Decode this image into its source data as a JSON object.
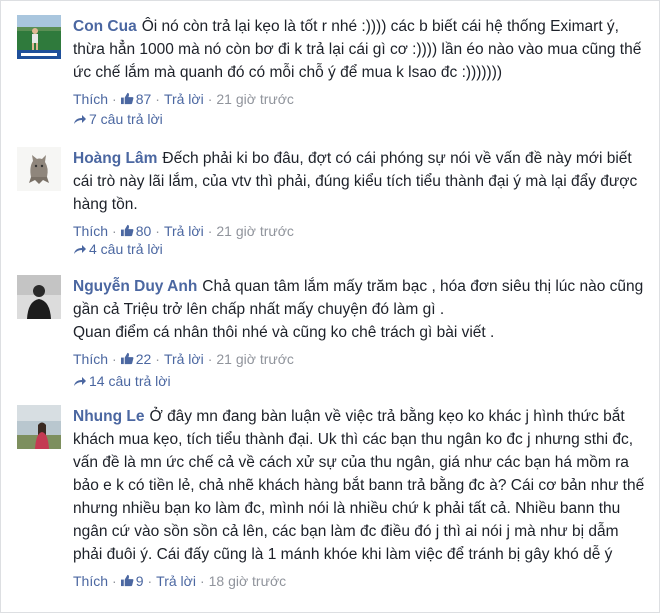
{
  "colors": {
    "link": "#4b67a1",
    "text": "#1d2129",
    "meta": "#90949c"
  },
  "comments": [
    {
      "author": "Con Cua",
      "text": "Ôi nó còn trả lại kẹo là tốt r nhé :)))) các b biết cái hệ thống Eximart ý, thừa hẳn 1000 mà nó còn bơ đi k trả lại cái gì cơ :)))) lần éo nào vào mua cũng thế ức chế lắm mà quanh đó có mỗi chỗ ý để mua k lsao đc :)))))))",
      "like_label": "Thích",
      "likes": "87",
      "reply_label": "Trả lời",
      "time": "21 giờ trước",
      "replies": "7 câu trả lời",
      "avatar_icon": "soccer-player-avatar"
    },
    {
      "author": "Hoàng Lâm",
      "text": "Đếch phải ki bo đâu, đợt có cái phóng sự nói về vấn đề này mới biết cái trò này lãi lắm, của vtv thì phải, đúng kiểu tích tiểu thành đại ý mà lại đẩy được hàng tồn.",
      "like_label": "Thích",
      "likes": "80",
      "reply_label": "Trả lời",
      "time": "21 giờ trước",
      "replies": "4 câu trả lời",
      "avatar_icon": "cat-avatar"
    },
    {
      "author": "Nguyễn Duy Anh",
      "text": "Chả quan tâm lắm mấy trăm bạc , hóa đơn siêu thị lúc nào cũng gần cả Triệu trở lên chấp nhất mấy chuyện đó làm gì .\nQuan điểm cá nhân thôi nhé và cũng ko chê trách gì bài viết .",
      "like_label": "Thích",
      "likes": "22",
      "reply_label": "Trả lời",
      "time": "21 giờ trước",
      "replies": "14 câu trả lời",
      "avatar_icon": "person-silhouette-avatar"
    },
    {
      "author": "Nhung Le",
      "text": "Ở đây mn đang bàn luận về việc trả bằng kẹo ko khác j hình thức bắt khách mua kẹo, tích tiểu thành đại. Uk thì các bạn thu ngân ko đc j nhưng sthi đc, vấn đề là mn ức chế cả về cách xử sự của thu ngân, giá như các bạn há mồm ra bảo e k có tiền lẻ, chả nhẽ khách hàng bắt bann trả bằng đc à? Cái cơ bản như thế nhưng nhiều bạn ko làm đc, mình nói là nhiều chứ k phải tất cả. Nhiều bann thu ngân cứ vào sồn sồn cả lên, các bạn làm đc điều đó j thì ai nói j mà như bị dẫm phải đuôi ý. Cái đấy cũng là 1 mánh khóe khi làm việc để tránh bị gây khó dễ ý",
      "like_label": "Thích",
      "likes": "9",
      "reply_label": "Trả lời",
      "time": "18 giờ trước",
      "avatar_icon": "woman-outdoor-avatar"
    }
  ]
}
